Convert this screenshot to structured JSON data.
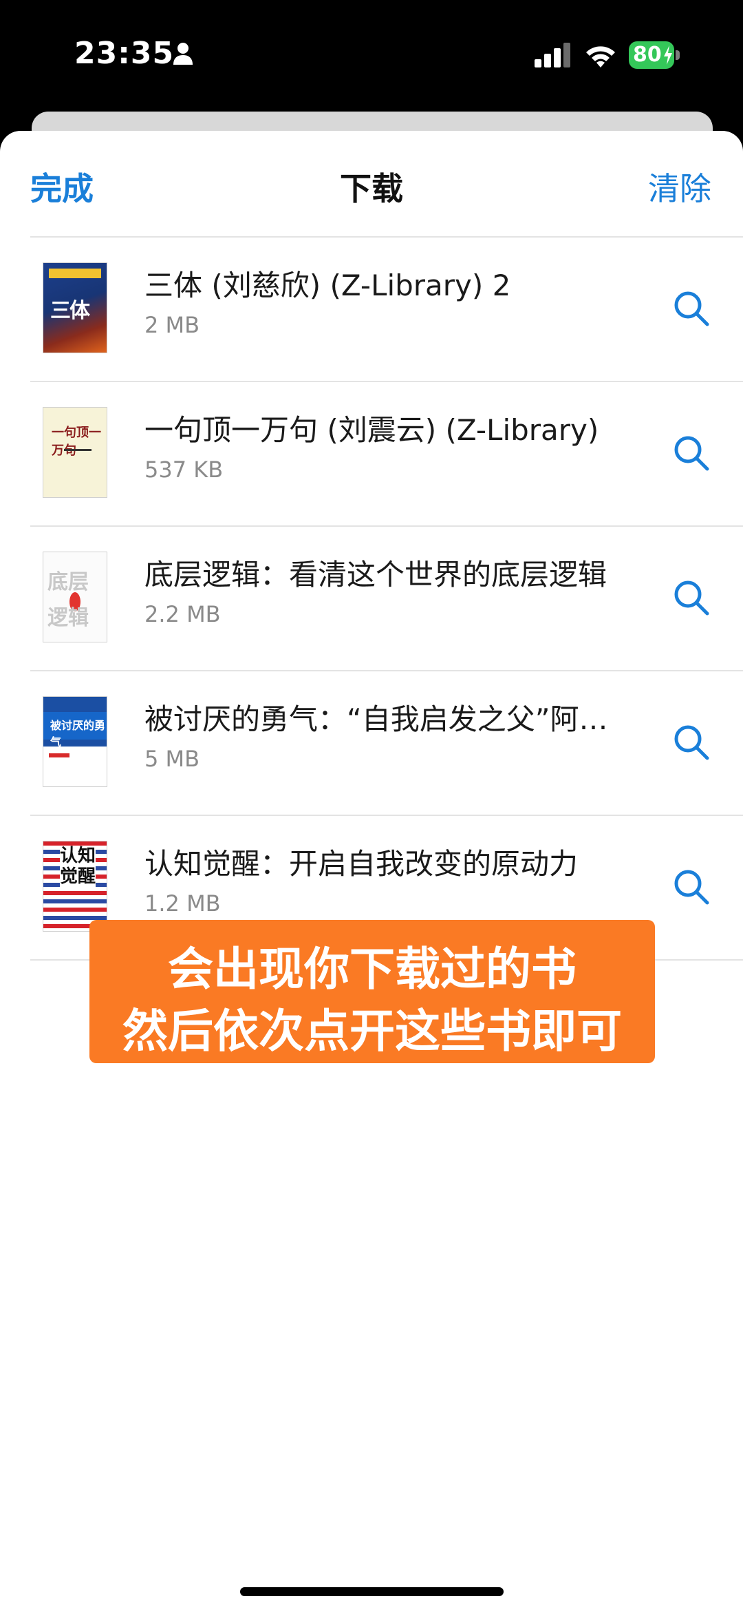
{
  "status_bar": {
    "time": "23:35",
    "battery_level": "80",
    "icons": [
      "person-icon",
      "signal-icon",
      "wifi-icon",
      "battery-icon"
    ]
  },
  "nav": {
    "done": "完成",
    "title": "下载",
    "clear": "清除",
    "accent_color": "#1a7fd9"
  },
  "downloads": [
    {
      "title": "三体 (刘慈欣) (Z-Library) 2",
      "size": "2 MB"
    },
    {
      "title": "一句顶一万句 (刘震云) (Z-Library)",
      "size": "537 KB"
    },
    {
      "title": "底层逻辑：看清这个世界的底层逻辑",
      "size": "2.2 MB"
    },
    {
      "title": "被讨厌的勇气：“自我启发之父”阿德勒的哲学课",
      "size": "5 MB"
    },
    {
      "title": "认知觉醒：开启自我改变的原动力",
      "size": "1.2 MB"
    }
  ],
  "covers": {
    "c1": "三体",
    "c2": "一句顶一万句",
    "c3_top": "底层",
    "c3_bottom": "逻辑",
    "c4": "被讨厌的勇气",
    "c5": "认知觉醒"
  },
  "caption": {
    "line1": "会出现你下载过的书",
    "line2": "然后依次点开这些书即可",
    "color": "#fa7a24"
  }
}
